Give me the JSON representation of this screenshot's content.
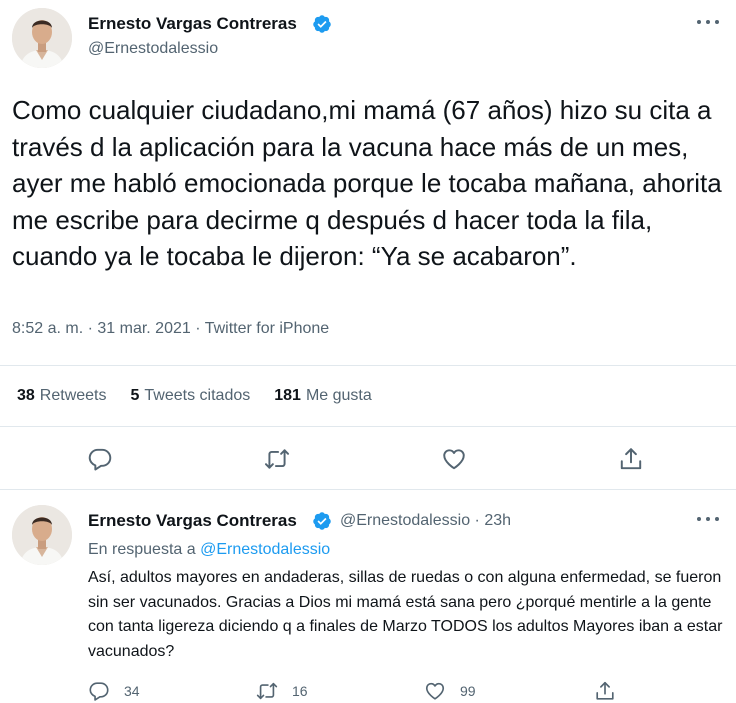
{
  "tweet": {
    "author_name": "Ernesto Vargas Contreras",
    "author_handle": "@Ernestodalessio",
    "text": "Como cualquier ciudadano,mi mamá (67 años) hizo su cita a través d la aplicación para la vacuna hace más de un mes, ayer me habló emocionada porque le tocaba mañana, ahorita me escribe para decirme q después d hacer toda la fila, cuando ya le tocaba le dijeron: “Ya se acabaron”.",
    "meta": "8:52 a. m. · 31 mar. 2021 · Twitter for iPhone",
    "stats": {
      "retweets_count": "38",
      "retweets_label": "Retweets",
      "quotes_count": "5",
      "quotes_label": "Tweets citados",
      "likes_count": "181",
      "likes_label": "Me gusta"
    },
    "actions": [
      "reply-icon",
      "retweet-icon",
      "like-icon",
      "share-icon"
    ]
  },
  "reply": {
    "author_name": "Ernesto Vargas Contreras",
    "author_handle": "@Ernestodalessio",
    "time": "· 23h",
    "reply_prefix": "En respuesta a",
    "reply_target": "@Ernestodalessio",
    "text": "Así, adultos mayores en andaderas, sillas de ruedas o con alguna enfermedad, se fueron sin ser vacunados. Gracias a Dios mi mamá está sana pero ¿porqué mentirle a la gente con tanta ligereza diciendo q a finales de Marzo TODOS los adultos Mayores iban a estar vacunados?",
    "reply_count": "34",
    "retweet_count": "16",
    "like_count": "99"
  },
  "colors": {
    "text": "#0f1419",
    "secondary": "#536471",
    "link": "#1d9bf0",
    "verified": "#1d9bf0",
    "divider": "#e1e8ed"
  }
}
